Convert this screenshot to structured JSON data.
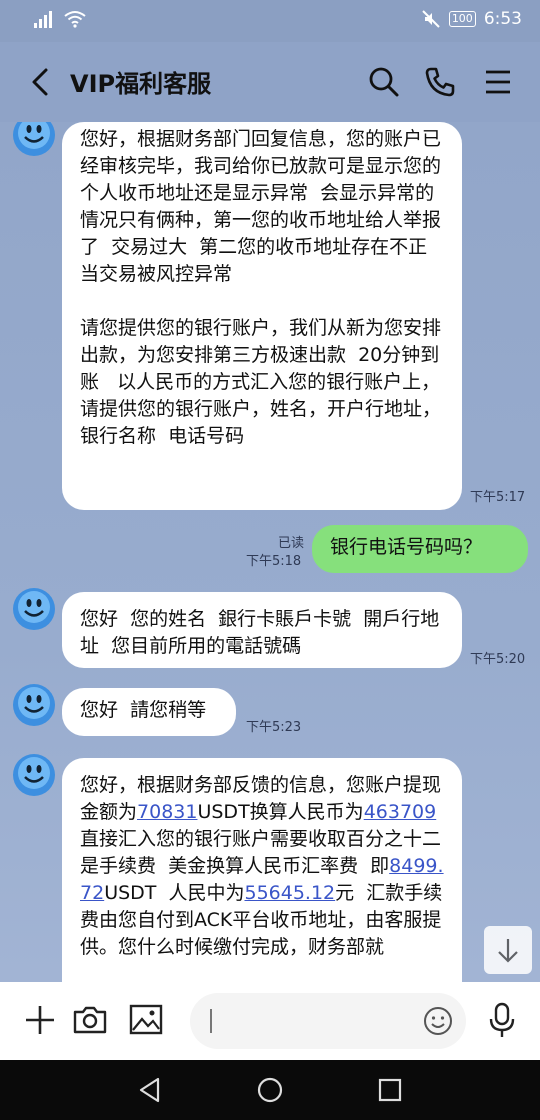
{
  "status": {
    "battery": "100",
    "time": "6:53"
  },
  "header": {
    "title": "VIP福利客服"
  },
  "messages": {
    "m1": {
      "text": "您好，根据财务部门回复信息，您的账户已经审核完毕，我司给你已放款可是显示您的个人收币地址还是显示异常  会显示异常的情况只有俩种，第一您的收币地址给人举报了  交易过大  第二您的收币地址存在不正当交易被风控异常\n\n请您提供您的银行账户，我们从新为您安排出款，为您安排第三方极速出款  20分钟到账   以人民币的方式汇入您的银行账户上，请提供您的银行账户，姓名，开户行地址，银行名称  电话号码",
      "time": "下午5:17"
    },
    "m2": {
      "text": "银行电话号码吗？",
      "read": "已读",
      "time": "下午5:18"
    },
    "m3": {
      "text": "您好  您的姓名  銀行卡賬戶卡號  開戶行地址  您目前所用的電話號碼",
      "time": "下午5:20"
    },
    "m4": {
      "text": "您好  請您稍等",
      "time": "下午5:23"
    },
    "m5": {
      "p1": "您好，根据财务部反馈的信息，您账户提现金额为",
      "n1": "70831",
      "p2": "USDT换算人民币为",
      "n2": "463709",
      "p3": "直接汇入您的银行账户需要收取百分之十二是手续费  美金换算人民币汇率费  即",
      "n3": "8499.72",
      "p4": "USDT  人民中为",
      "n4": "55645.12",
      "p5": "元  汇款手续费由您自付到ACK平台收币地址，由客服提供。您什么时候缴付完成，财务部就"
    }
  },
  "colors": {
    "header_bg": "#8fa3c7",
    "my_bubble": "#86e07c",
    "link": "#3a55c8"
  }
}
